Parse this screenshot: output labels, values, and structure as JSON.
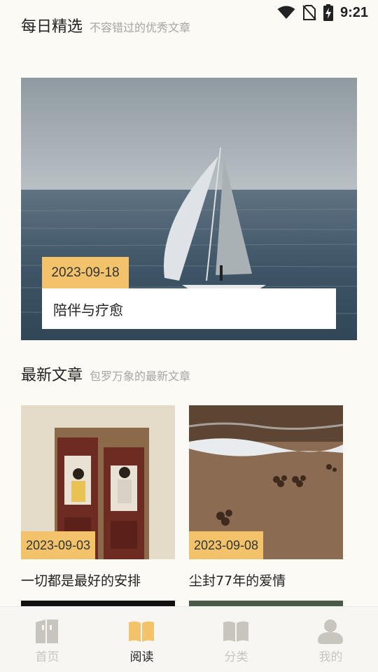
{
  "status_bar": {
    "time": "9:21",
    "icons": [
      "wifi-icon",
      "no-sim-icon",
      "battery-charging-icon"
    ]
  },
  "daily_section": {
    "title": "每日精选",
    "subtitle": "不容错过的优秀文章"
  },
  "featured_article": {
    "date": "2023-09-18",
    "title": "陪伴与疗愈",
    "image": "sailboat-on-sea"
  },
  "latest_section": {
    "title": "最新文章",
    "subtitle": "包罗万象的最新文章"
  },
  "articles": [
    {
      "date": "2023-09-03",
      "title": "一切都是最好的安排",
      "image": "couple-in-doorway"
    },
    {
      "date": "2023-09-08",
      "title": "尘封77年的爱情",
      "image": "pawprints-on-beach"
    }
  ],
  "tabbar": {
    "tabs": [
      {
        "label": "首页",
        "icon": "home-icon",
        "active": false
      },
      {
        "label": "阅读",
        "icon": "book-icon",
        "active": true
      },
      {
        "label": "分类",
        "icon": "category-book-icon",
        "active": false
      },
      {
        "label": "我的",
        "icon": "user-icon",
        "active": false
      }
    ]
  },
  "colors": {
    "background": "#fcfaf4",
    "accent": "#f2c36b",
    "tab_inactive": "#c8c5be",
    "text": "#222222",
    "subtext": "#a5a5a5"
  }
}
